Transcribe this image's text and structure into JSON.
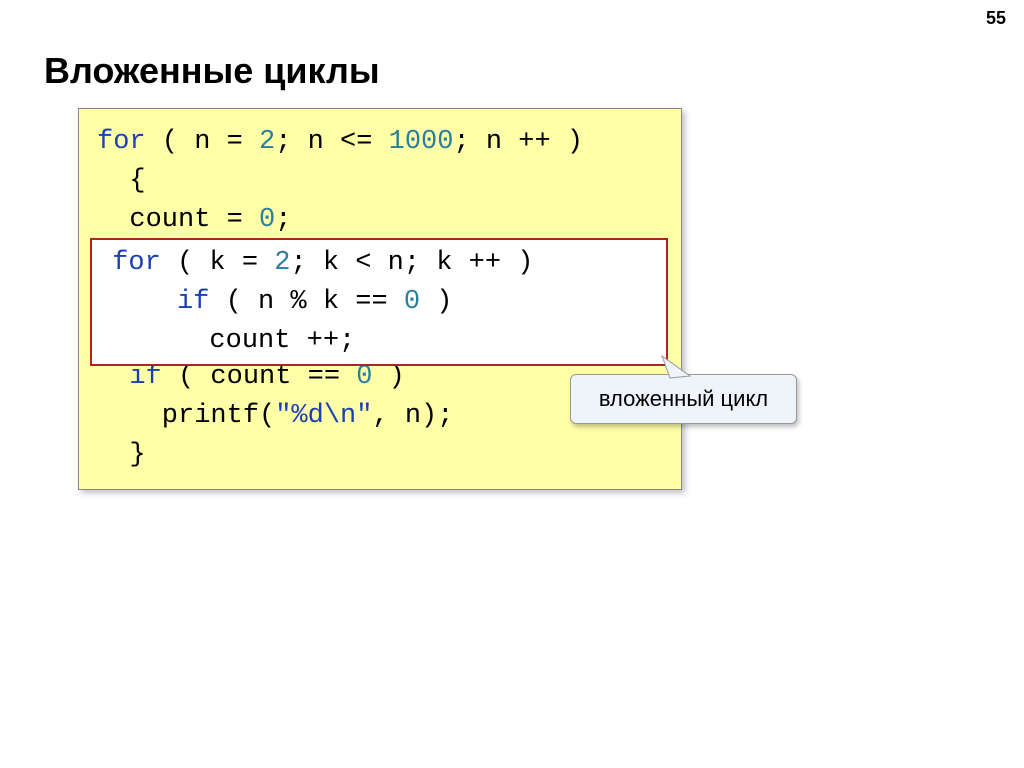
{
  "page_number": "55",
  "title": "Вложенные циклы",
  "callout": "вложенный цикл",
  "code": {
    "l1_for": "for",
    "l1_a": " ( n = ",
    "l1_n2": "2",
    "l1_b": "; n <= ",
    "l1_n1000": "1000",
    "l1_c": "; n ++ )",
    "l2": "  {",
    "l3_a": "  count = ",
    "l3_n0": "0",
    "l3_b": ";",
    "inner": {
      "l1_for": "for",
      "l1_a": " ( k = ",
      "l1_n2": "2",
      "l1_b": "; k < n; k ++ )",
      "l2_if": "if",
      "l2_a": " ( n % k == ",
      "l2_n0": "0",
      "l2_b": " )",
      "l3": "       count ++;"
    },
    "l7_if": "if",
    "l7_a": " ( count == ",
    "l7_n0": "0",
    "l7_b": " )",
    "l8_a": "    printf(",
    "l8_str": "\"%d\\n\"",
    "l8_b": ", n);",
    "l9": "  }"
  }
}
